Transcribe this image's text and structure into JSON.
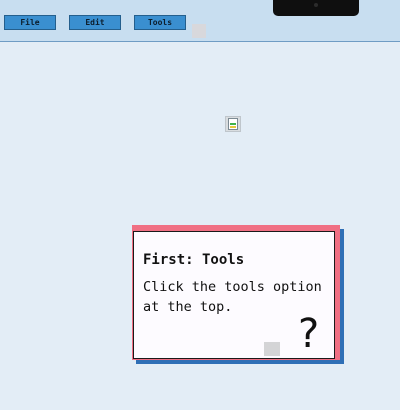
{
  "menu": {
    "file_label": "File",
    "edit_label": "Edit",
    "tools_label": "Tools"
  },
  "icons": {
    "file_icon": "spreadsheet-file-icon",
    "help_icon": "question-mark-icon"
  },
  "tooltip": {
    "title": "First: Tools",
    "body": "Click the tools option at the top.",
    "help_glyph": "?"
  },
  "colors": {
    "menu_button": "#3a8fd0",
    "topbar": "#c8def0",
    "background": "#e3edf6",
    "card_border": "#f06f83",
    "card_shadow": "#2f6fb6"
  }
}
